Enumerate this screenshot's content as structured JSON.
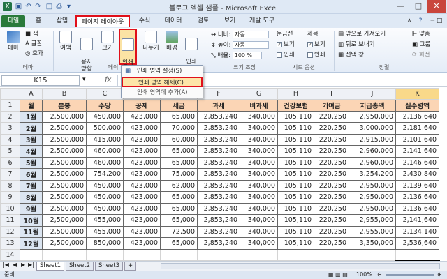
{
  "window": {
    "title": "블로그 엑셀 샘플 - Microsoft Excel"
  },
  "tabs": [
    "파일",
    "홈",
    "삽입",
    "페이지 레이아웃",
    "수식",
    "데이터",
    "검토",
    "보기",
    "개발 도구"
  ],
  "ribbon": {
    "theme": {
      "label": "테마",
      "items": [
        "색",
        "글꼴",
        "효과"
      ],
      "group": "테마"
    },
    "margins": "여백",
    "orientation": "용지\n방향",
    "size": "크기",
    "print_area": "인쇄\n영역",
    "breaks": "나누기",
    "background": "배경",
    "print_titles": "인쇄\n제목",
    "page_setup_group": "페이",
    "width_label": "너비:",
    "width_value": "자동",
    "height_label": "높이:",
    "height_value": "자동",
    "scale_label": "배율:",
    "scale_value": "100 %",
    "scale_group": "크기 조정",
    "gridlines": "눈금선",
    "headings": "제목",
    "view": "보기",
    "print": "인쇄",
    "sheet_options_group": "시트 옵션",
    "bring_forward": "앞으로 가져오기",
    "send_backward": "뒤로 보내기",
    "selection_pane": "선택 창",
    "align": "맞춤",
    "group": "그룹",
    "rotate": "회전",
    "arrange_group": "정렬"
  },
  "print_area_menu": {
    "items": [
      "인쇄 영역 설정(S)",
      "인쇄 영역 해제(C)",
      "인쇄 영역에 추가(A)"
    ],
    "highlighted": "인쇄 영역 해제(C)"
  },
  "formula_bar": {
    "name_box": "K15",
    "fx": "fx"
  },
  "columns": [
    "A",
    "B",
    "C",
    "D",
    "E",
    "F",
    "G",
    "H",
    "I",
    "J",
    "K"
  ],
  "rows": [
    "1",
    "2",
    "3",
    "4",
    "5",
    "6",
    "7",
    "8",
    "9",
    "10",
    "11",
    "12",
    "13",
    "14",
    "15"
  ],
  "table": {
    "headers": [
      "월",
      "본봉",
      "수당",
      "공제",
      "세금",
      "과세",
      "비과세",
      "건강보험",
      "기여금",
      "지급총액",
      "실수령액"
    ],
    "data": [
      [
        "1월",
        "2,500,000",
        "450,000",
        "423,000",
        "65,000",
        "2,853,240",
        "340,000",
        "105,110",
        "220,250",
        "2,950,000",
        "2,136,640"
      ],
      [
        "2월",
        "2,500,000",
        "500,000",
        "423,000",
        "70,000",
        "2,853,240",
        "340,000",
        "105,110",
        "220,250",
        "3,000,000",
        "2,181,640"
      ],
      [
        "3월",
        "2,500,000",
        "415,000",
        "423,000",
        "60,000",
        "2,853,240",
        "340,000",
        "105,110",
        "220,250",
        "2,915,000",
        "2,101,640"
      ],
      [
        "4월",
        "2,500,000",
        "460,000",
        "423,000",
        "65,000",
        "2,853,240",
        "340,000",
        "105,110",
        "220,250",
        "2,960,000",
        "2,141,640"
      ],
      [
        "5월",
        "2,500,000",
        "460,000",
        "423,000",
        "65,000",
        "2,853,240",
        "340,000",
        "105,110",
        "220,250",
        "2,960,000",
        "2,146,640"
      ],
      [
        "6월",
        "2,500,000",
        "754,200",
        "423,000",
        "75,000",
        "2,853,240",
        "340,000",
        "105,110",
        "220,250",
        "3,254,200",
        "2,430,840"
      ],
      [
        "7월",
        "2,500,000",
        "450,000",
        "423,000",
        "62,000",
        "2,853,240",
        "340,000",
        "105,110",
        "220,250",
        "2,950,000",
        "2,139,640"
      ],
      [
        "8월",
        "2,500,000",
        "450,000",
        "423,000",
        "65,000",
        "2,853,240",
        "340,000",
        "105,110",
        "220,250",
        "2,950,000",
        "2,136,640"
      ],
      [
        "9월",
        "2,500,000",
        "450,000",
        "423,000",
        "65,000",
        "2,853,240",
        "340,000",
        "105,110",
        "220,250",
        "2,950,000",
        "2,136,640"
      ],
      [
        "10월",
        "2,500,000",
        "455,000",
        "423,000",
        "65,000",
        "2,853,240",
        "340,000",
        "105,110",
        "220,250",
        "2,955,000",
        "2,141,640"
      ],
      [
        "11월",
        "2,500,000",
        "455,000",
        "423,000",
        "72,500",
        "2,853,240",
        "340,000",
        "105,110",
        "220,250",
        "2,955,000",
        "2,134,140"
      ],
      [
        "12월",
        "2,500,000",
        "850,000",
        "423,000",
        "65,000",
        "2,853,240",
        "340,000",
        "105,110",
        "220,250",
        "3,350,000",
        "2,536,640"
      ]
    ]
  },
  "sheets": [
    "Sheet1",
    "Sheet2",
    "Sheet3"
  ],
  "status": {
    "ready": "준비",
    "zoom": "100%"
  }
}
